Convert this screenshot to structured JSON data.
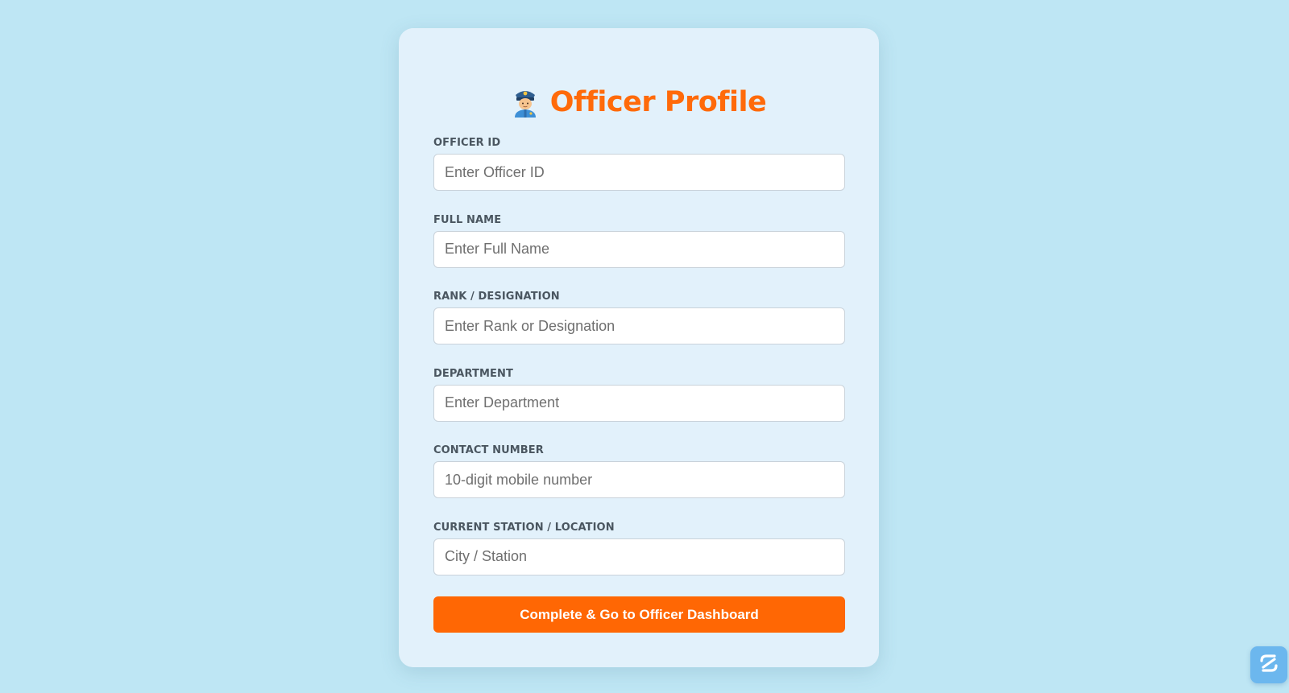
{
  "header": {
    "title": "Officer Profile",
    "icon": "police-officer-icon"
  },
  "form": {
    "fields": [
      {
        "label": "OFFICER ID",
        "placeholder": "Enter Officer ID",
        "value": ""
      },
      {
        "label": "FULL NAME",
        "placeholder": "Enter Full Name",
        "value": ""
      },
      {
        "label": "RANK / DESIGNATION",
        "placeholder": "Enter Rank or Designation",
        "value": ""
      },
      {
        "label": "DEPARTMENT",
        "placeholder": "Enter Department",
        "value": ""
      },
      {
        "label": "CONTACT NUMBER",
        "placeholder": "10-digit mobile number",
        "value": ""
      },
      {
        "label": "CURRENT STATION / LOCATION",
        "placeholder": "City / Station",
        "value": ""
      }
    ],
    "submit_label": "Complete & Go to Officer Dashboard"
  },
  "corner_widget": {
    "icon": "app-widget-icon"
  },
  "colors": {
    "background": "#bee6f4",
    "card": "#e2f1fb",
    "accent": "#ff6704",
    "label": "#4a5660"
  }
}
